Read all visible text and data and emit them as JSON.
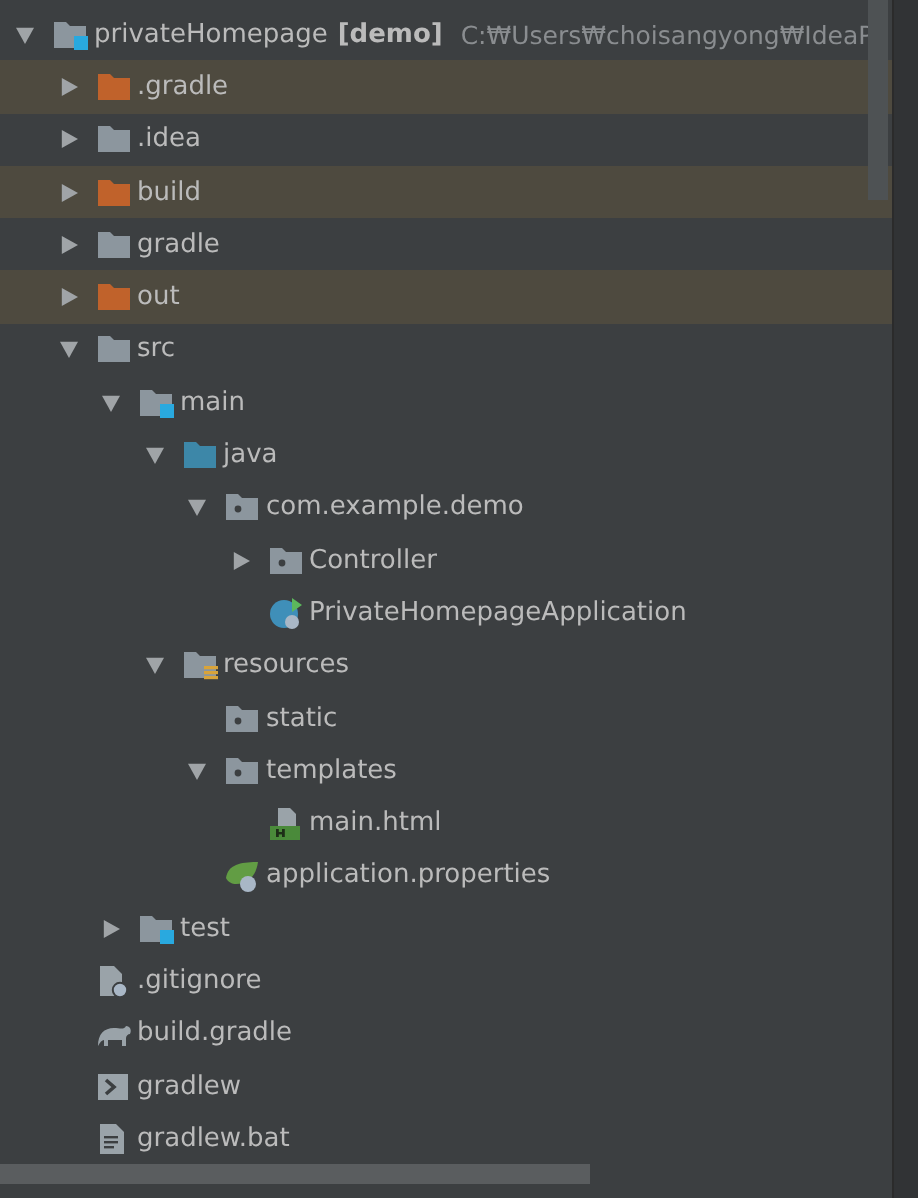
{
  "tree": [
    {
      "kind": "module",
      "label": "privateHomepage",
      "module": "[demo]",
      "path": "C:₩Users₩choisangyong₩IdeaP",
      "expanded": true,
      "children": [
        {
          "kind": "folder",
          "label": ".gradle",
          "excluded": true,
          "expanded": false
        },
        {
          "kind": "folder",
          "label": ".idea",
          "excluded": false,
          "expanded": false
        },
        {
          "kind": "folder",
          "label": "build",
          "excluded": true,
          "expanded": false
        },
        {
          "kind": "folder",
          "label": "gradle",
          "excluded": false,
          "expanded": false
        },
        {
          "kind": "folder",
          "label": "out",
          "excluded": true,
          "expanded": false
        },
        {
          "kind": "folder",
          "label": "src",
          "excluded": false,
          "expanded": true,
          "children": [
            {
              "kind": "module-folder",
              "label": "main",
              "excluded": false,
              "expanded": true,
              "children": [
                {
                  "kind": "source-root",
                  "label": "java",
                  "excluded": false,
                  "expanded": true,
                  "children": [
                    {
                      "kind": "package",
                      "label": "com.example.demo",
                      "excluded": false,
                      "expanded": true,
                      "children": [
                        {
                          "kind": "package",
                          "label": "Controller",
                          "excluded": false,
                          "expanded": false
                        },
                        {
                          "kind": "spring-class",
                          "label": "PrivateHomepageApplication"
                        }
                      ]
                    }
                  ]
                },
                {
                  "kind": "resources-root",
                  "label": "resources",
                  "excluded": false,
                  "expanded": true,
                  "children": [
                    {
                      "kind": "package",
                      "label": "static",
                      "excluded": false
                    },
                    {
                      "kind": "package",
                      "label": "templates",
                      "excluded": false,
                      "expanded": true,
                      "children": [
                        {
                          "kind": "html-file",
                          "label": "main.html"
                        }
                      ]
                    },
                    {
                      "kind": "spring-config",
                      "label": "application.properties"
                    }
                  ]
                }
              ]
            },
            {
              "kind": "module-folder",
              "label": "test",
              "excluded": false,
              "expanded": false
            }
          ]
        },
        {
          "kind": "ignore-file",
          "label": ".gitignore"
        },
        {
          "kind": "gradle-file",
          "label": "build.gradle"
        },
        {
          "kind": "shell-file",
          "label": "gradlew"
        },
        {
          "kind": "text-file",
          "label": "gradlew.bat"
        }
      ]
    }
  ]
}
